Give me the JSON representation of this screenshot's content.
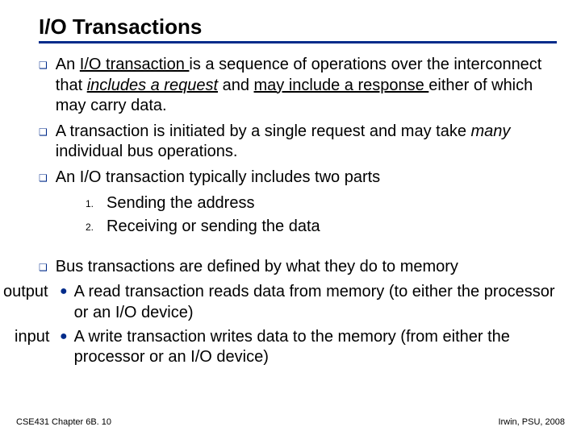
{
  "title": "I/O Transactions",
  "b1_pre": "An ",
  "b1_term": "I/O transaction ",
  "b1_mid1": "is a sequence of operations over the interconnect that ",
  "b1_it1": "includes a request",
  "b1_mid2": "  and ",
  "b1_ul2": "may include a response ",
  "b1_post": "either of which may carry data.",
  "b2_pre": "A transaction is initiated by a single request and may take ",
  "b2_it": "many",
  "b2_post": " individual bus operations.",
  "b3": "An I/O transaction typically includes two parts",
  "ol1_num": "1.",
  "ol1": "Sending the address",
  "ol2_num": "2.",
  "ol2": "Receiving or sending the data",
  "b4": "Bus transactions are defined by what they do to memory",
  "sub1_pre": "A ",
  "sub1_rw": "read",
  "sub1_post": " transaction reads data from memory (to either the processor or an I/O device)",
  "sub2_pre": "A ",
  "sub2_rw": "write",
  "sub2_post": " transaction writes data to the memory (from either the processor or an I/O device)",
  "label_output": "output",
  "label_input": "input",
  "footer_left": "CSE431  Chapter 6B. 10",
  "footer_right": "Irwin, PSU, 2008"
}
